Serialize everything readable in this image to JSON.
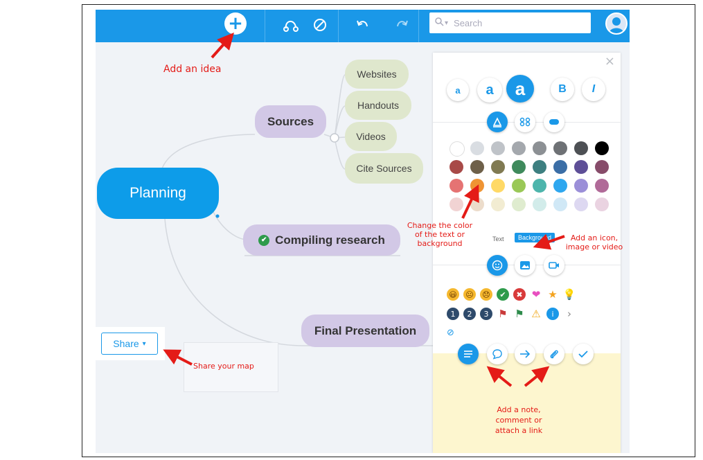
{
  "toolbar": {
    "add_icon": "+",
    "search_placeholder": "Search",
    "search_dropdown": "▾"
  },
  "mindmap": {
    "central": "Planning",
    "branches": [
      {
        "label": "Sources",
        "children": [
          "Websites",
          "Handouts",
          "Videos",
          "Cite Sources"
        ]
      },
      {
        "label": "Compiling research",
        "check": "✔"
      },
      {
        "label": "Final Presentation"
      }
    ]
  },
  "panel": {
    "close": "×",
    "font_sizes": [
      "a",
      "a",
      "a"
    ],
    "bold": "B",
    "italic": "I",
    "text_label": "Text",
    "background_label": "Background",
    "colors": {
      "row1": [
        "#ffffff",
        "#d9dde2",
        "#bfc3c8",
        "#a4a8ad",
        "#8c9094",
        "#6e7175",
        "#4d5054",
        "#000000"
      ],
      "row2": [
        "#a84a48",
        "#6e6049",
        "#807a52",
        "#3f8a5c",
        "#3d7f80",
        "#3b6ea6",
        "#5e4f97",
        "#874c6a"
      ],
      "row3": [
        "#e57373",
        "#ef9433",
        "#ffd966",
        "#9ac857",
        "#4db5ac",
        "#2ea7ef",
        "#9b8fd8",
        "#b06a98"
      ],
      "row4": [
        "#f1d3d3",
        "#ecdccb",
        "#f2ecd2",
        "#dfeccf",
        "#d2ecea",
        "#d0e8f6",
        "#ddd8f1",
        "#ead3e1"
      ]
    },
    "emojis_row1": [
      "😃",
      "😐",
      "😞",
      "✔",
      "✖",
      "❤",
      "★",
      "💡"
    ],
    "emojis_row2": [
      "1",
      "2",
      "3",
      "⚑",
      "⚑",
      "⚠",
      "i",
      "›"
    ],
    "none_symbol": "⊘"
  },
  "share": {
    "label": "Share",
    "caret": "▾"
  },
  "annotations": {
    "add_idea": "Add an idea",
    "share_map": "Share your map",
    "change_color": [
      "Change the color",
      "of the text or",
      "background"
    ],
    "add_media": [
      "Add an icon,",
      "image or video"
    ],
    "add_note": [
      "Add a note,",
      "comment or",
      "attach a link"
    ]
  },
  "colors": {
    "accent": "#1a98e8",
    "annotation": "#e41b17",
    "purple_node": "#d2c8e6",
    "green_node": "#dfe7cd"
  }
}
